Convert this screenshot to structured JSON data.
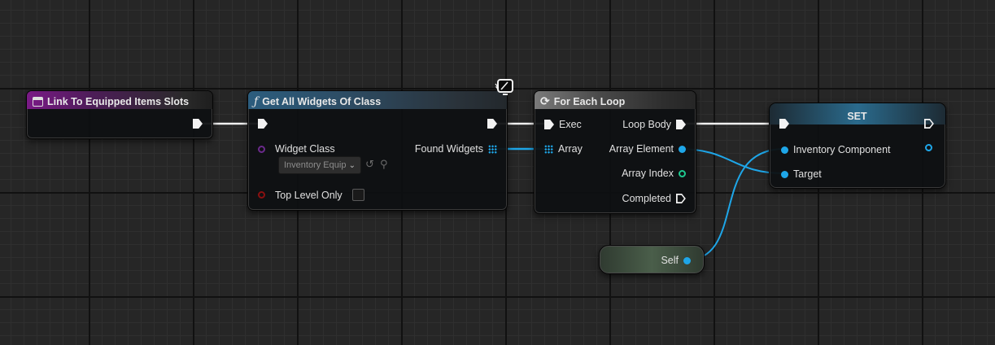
{
  "nodes": {
    "event": {
      "title": "Link To Equipped Items Slots"
    },
    "get_widgets": {
      "icon": "function-f-icon",
      "func_glyph": "ƒ",
      "title": "Get All Widgets Of Class",
      "pin_widget_class": "Widget Class",
      "widget_class_value": "Inventory Equip",
      "pin_top_level_only": "Top Level Only",
      "pin_found_widgets": "Found Widgets"
    },
    "for_each": {
      "icon": "loop-icon",
      "title": "For Each Loop",
      "pin_exec": "Exec",
      "pin_array": "Array",
      "pin_loop_body": "Loop Body",
      "pin_array_element": "Array Element",
      "pin_array_index": "Array Index",
      "pin_completed": "Completed"
    },
    "set": {
      "title": "SET",
      "pin_inventory_component": "Inventory Component",
      "pin_target": "Target"
    },
    "self": {
      "label": "Self"
    }
  },
  "colors": {
    "exec": "#f2f2f2",
    "object_pin": "#1ea6e8",
    "class_pin": "#6b2a8c",
    "bool_pin": "#8b1010",
    "int_pin": "#1ec88f"
  }
}
